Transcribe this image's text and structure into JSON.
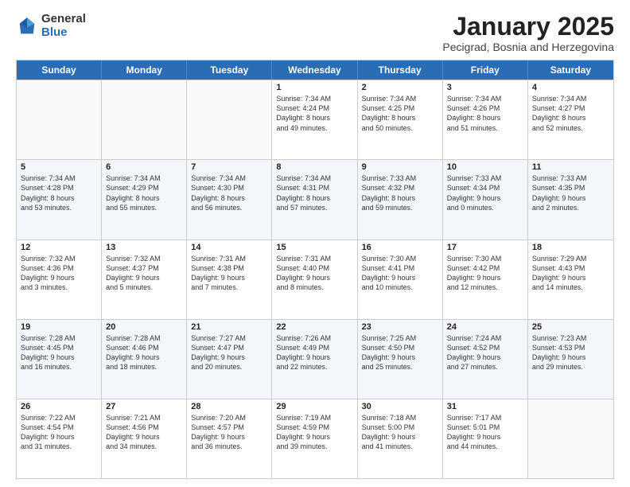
{
  "logo": {
    "general": "General",
    "blue": "Blue"
  },
  "title": "January 2025",
  "location": "Pecigrad, Bosnia and Herzegovina",
  "days": [
    "Sunday",
    "Monday",
    "Tuesday",
    "Wednesday",
    "Thursday",
    "Friday",
    "Saturday"
  ],
  "rows": [
    [
      {
        "day": "",
        "text": "",
        "empty": true
      },
      {
        "day": "",
        "text": "",
        "empty": true
      },
      {
        "day": "",
        "text": "",
        "empty": true
      },
      {
        "day": "1",
        "text": "Sunrise: 7:34 AM\nSunset: 4:24 PM\nDaylight: 8 hours\nand 49 minutes.",
        "empty": false
      },
      {
        "day": "2",
        "text": "Sunrise: 7:34 AM\nSunset: 4:25 PM\nDaylight: 8 hours\nand 50 minutes.",
        "empty": false
      },
      {
        "day": "3",
        "text": "Sunrise: 7:34 AM\nSunset: 4:26 PM\nDaylight: 8 hours\nand 51 minutes.",
        "empty": false
      },
      {
        "day": "4",
        "text": "Sunrise: 7:34 AM\nSunset: 4:27 PM\nDaylight: 8 hours\nand 52 minutes.",
        "empty": false
      }
    ],
    [
      {
        "day": "5",
        "text": "Sunrise: 7:34 AM\nSunset: 4:28 PM\nDaylight: 8 hours\nand 53 minutes.",
        "empty": false
      },
      {
        "day": "6",
        "text": "Sunrise: 7:34 AM\nSunset: 4:29 PM\nDaylight: 8 hours\nand 55 minutes.",
        "empty": false
      },
      {
        "day": "7",
        "text": "Sunrise: 7:34 AM\nSunset: 4:30 PM\nDaylight: 8 hours\nand 56 minutes.",
        "empty": false
      },
      {
        "day": "8",
        "text": "Sunrise: 7:34 AM\nSunset: 4:31 PM\nDaylight: 8 hours\nand 57 minutes.",
        "empty": false
      },
      {
        "day": "9",
        "text": "Sunrise: 7:33 AM\nSunset: 4:32 PM\nDaylight: 8 hours\nand 59 minutes.",
        "empty": false
      },
      {
        "day": "10",
        "text": "Sunrise: 7:33 AM\nSunset: 4:34 PM\nDaylight: 9 hours\nand 0 minutes.",
        "empty": false
      },
      {
        "day": "11",
        "text": "Sunrise: 7:33 AM\nSunset: 4:35 PM\nDaylight: 9 hours\nand 2 minutes.",
        "empty": false
      }
    ],
    [
      {
        "day": "12",
        "text": "Sunrise: 7:32 AM\nSunset: 4:36 PM\nDaylight: 9 hours\nand 3 minutes.",
        "empty": false
      },
      {
        "day": "13",
        "text": "Sunrise: 7:32 AM\nSunset: 4:37 PM\nDaylight: 9 hours\nand 5 minutes.",
        "empty": false
      },
      {
        "day": "14",
        "text": "Sunrise: 7:31 AM\nSunset: 4:38 PM\nDaylight: 9 hours\nand 7 minutes.",
        "empty": false
      },
      {
        "day": "15",
        "text": "Sunrise: 7:31 AM\nSunset: 4:40 PM\nDaylight: 9 hours\nand 8 minutes.",
        "empty": false
      },
      {
        "day": "16",
        "text": "Sunrise: 7:30 AM\nSunset: 4:41 PM\nDaylight: 9 hours\nand 10 minutes.",
        "empty": false
      },
      {
        "day": "17",
        "text": "Sunrise: 7:30 AM\nSunset: 4:42 PM\nDaylight: 9 hours\nand 12 minutes.",
        "empty": false
      },
      {
        "day": "18",
        "text": "Sunrise: 7:29 AM\nSunset: 4:43 PM\nDaylight: 9 hours\nand 14 minutes.",
        "empty": false
      }
    ],
    [
      {
        "day": "19",
        "text": "Sunrise: 7:28 AM\nSunset: 4:45 PM\nDaylight: 9 hours\nand 16 minutes.",
        "empty": false
      },
      {
        "day": "20",
        "text": "Sunrise: 7:28 AM\nSunset: 4:46 PM\nDaylight: 9 hours\nand 18 minutes.",
        "empty": false
      },
      {
        "day": "21",
        "text": "Sunrise: 7:27 AM\nSunset: 4:47 PM\nDaylight: 9 hours\nand 20 minutes.",
        "empty": false
      },
      {
        "day": "22",
        "text": "Sunrise: 7:26 AM\nSunset: 4:49 PM\nDaylight: 9 hours\nand 22 minutes.",
        "empty": false
      },
      {
        "day": "23",
        "text": "Sunrise: 7:25 AM\nSunset: 4:50 PM\nDaylight: 9 hours\nand 25 minutes.",
        "empty": false
      },
      {
        "day": "24",
        "text": "Sunrise: 7:24 AM\nSunset: 4:52 PM\nDaylight: 9 hours\nand 27 minutes.",
        "empty": false
      },
      {
        "day": "25",
        "text": "Sunrise: 7:23 AM\nSunset: 4:53 PM\nDaylight: 9 hours\nand 29 minutes.",
        "empty": false
      }
    ],
    [
      {
        "day": "26",
        "text": "Sunrise: 7:22 AM\nSunset: 4:54 PM\nDaylight: 9 hours\nand 31 minutes.",
        "empty": false
      },
      {
        "day": "27",
        "text": "Sunrise: 7:21 AM\nSunset: 4:56 PM\nDaylight: 9 hours\nand 34 minutes.",
        "empty": false
      },
      {
        "day": "28",
        "text": "Sunrise: 7:20 AM\nSunset: 4:57 PM\nDaylight: 9 hours\nand 36 minutes.",
        "empty": false
      },
      {
        "day": "29",
        "text": "Sunrise: 7:19 AM\nSunset: 4:59 PM\nDaylight: 9 hours\nand 39 minutes.",
        "empty": false
      },
      {
        "day": "30",
        "text": "Sunrise: 7:18 AM\nSunset: 5:00 PM\nDaylight: 9 hours\nand 41 minutes.",
        "empty": false
      },
      {
        "day": "31",
        "text": "Sunrise: 7:17 AM\nSunset: 5:01 PM\nDaylight: 9 hours\nand 44 minutes.",
        "empty": false
      },
      {
        "day": "",
        "text": "",
        "empty": true
      }
    ]
  ]
}
